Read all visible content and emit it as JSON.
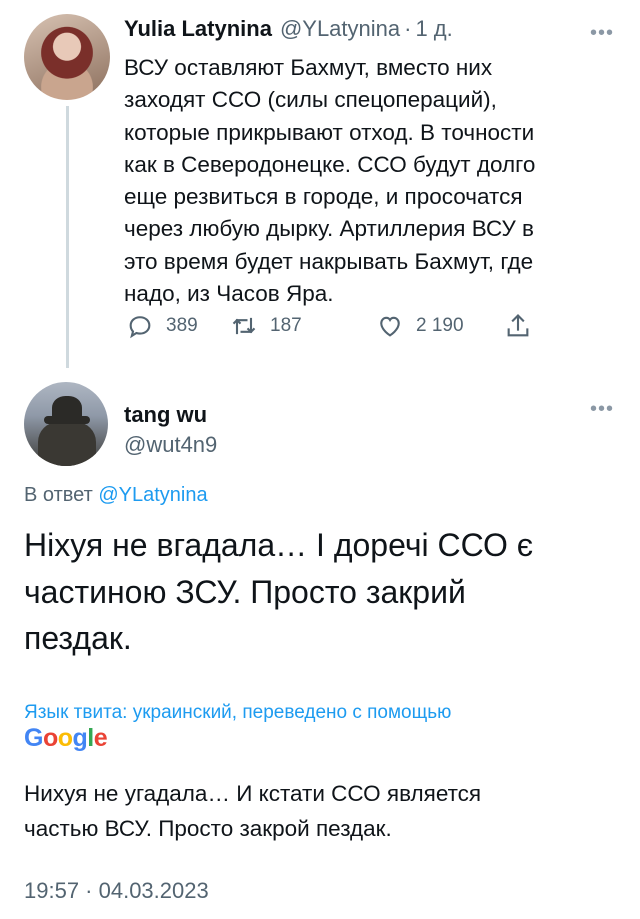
{
  "tweet1": {
    "author_name": "Yulia Latynina",
    "author_handle": "@YLatynina",
    "separator": "·",
    "time_ago": "1 д.",
    "text_lines": [
      "ВСУ оставляют Бахмут, вместо них",
      "заходят ССО (силы спецопераций),",
      "которые прикрывают отход. В точности",
      "как в Северодонецке. ССО будут долго",
      "еще резвиться в городе, и просочатся",
      "через любую дырку. Артиллерия ВСУ в",
      "это время будет накрывать Бахмут, где",
      "надо, из Часов Яра."
    ],
    "actions": {
      "replies": "389",
      "retweets": "187",
      "likes": "2 190"
    }
  },
  "tweet2": {
    "author_name": "tang wu",
    "author_handle": "@wut4n9",
    "reply_prefix": "В ответ",
    "reply_handle": "@YLatynina",
    "text_lines": [
      "Ніхуя не вгадала… І доречі ССО є",
      "частиною ЗСУ. Просто закрий",
      "пездак."
    ],
    "translation_notice": "Язык твита: украинский, переведено с помощью",
    "translation_provider": "Google",
    "translation_lines": [
      "Нихуя не угадала… И кстати ССО является",
      "частью ВСУ. Просто закрой пездак."
    ],
    "timestamp": "19:57 · 04.03.2023"
  },
  "icons": {
    "more": "more-horizontal-icon",
    "reply": "reply-icon",
    "retweet": "retweet-icon",
    "like": "heart-icon",
    "share": "share-icon"
  },
  "colors": {
    "link": "#1d9bf0",
    "secondary_text": "#536471",
    "primary_text": "#0f1419",
    "thread_line": "#cfd9de",
    "google_blue": "#4285f4",
    "google_red": "#ea4335",
    "google_yellow": "#fbbc05",
    "google_green": "#34a853"
  }
}
